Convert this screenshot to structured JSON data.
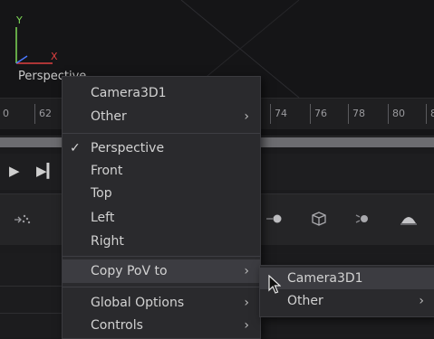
{
  "viewport": {
    "axis_y": "Y",
    "axis_x": "X",
    "view_label": "Perspective"
  },
  "ruler": {
    "ticks": [
      "0",
      "62",
      "74",
      "76",
      "78",
      "80",
      "8"
    ]
  },
  "transport": {
    "play_icon": "play-icon",
    "step_end_icon": "step-end-icon"
  },
  "context_menu": {
    "items": [
      {
        "label": "Camera3D1",
        "submenu": false
      },
      {
        "label": "Other",
        "submenu": true
      },
      {
        "label": "Perspective",
        "checked": true
      },
      {
        "label": "Front"
      },
      {
        "label": "Top"
      },
      {
        "label": "Left"
      },
      {
        "label": "Right"
      },
      {
        "label": "Copy PoV to",
        "submenu": true,
        "highlighted": true
      },
      {
        "label": "Global Options",
        "submenu": true
      },
      {
        "label": "Controls",
        "submenu": true
      }
    ],
    "arrow": "›",
    "check": "✓"
  },
  "submenu": {
    "items": [
      {
        "label": "Camera3D1",
        "highlighted": true
      },
      {
        "label": "Other",
        "submenu": true
      }
    ]
  },
  "colors": {
    "menu_bg": "#2a2a2d",
    "highlight": "#3c3c41",
    "axis_y": "#7ed957",
    "axis_x": "#e04040"
  }
}
